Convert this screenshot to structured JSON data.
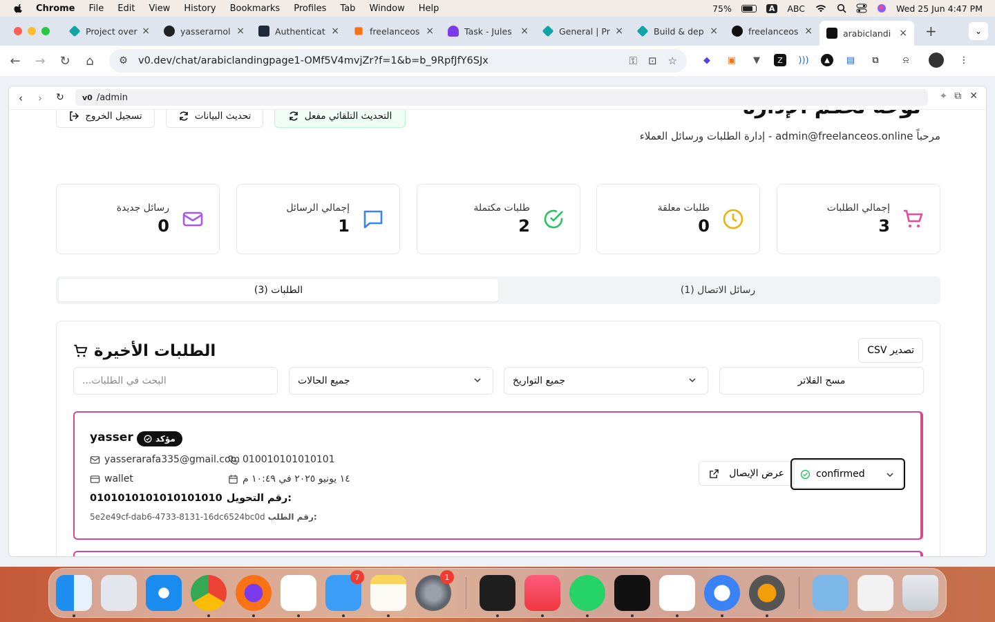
{
  "menubar": {
    "app": "Chrome",
    "items": [
      "File",
      "Edit",
      "View",
      "History",
      "Bookmarks",
      "Profiles",
      "Tab",
      "Window",
      "Help"
    ],
    "battery": "75%",
    "input_badge": "A",
    "input_source": "ABC",
    "datetime": "Wed 25 Jun  4:47 PM"
  },
  "tabs": [
    {
      "label": "Project over",
      "color": "#0ea5a4"
    },
    {
      "label": "yasserarnol",
      "color": "#222222"
    },
    {
      "label": "Authenticat",
      "color": "#1f2937"
    },
    {
      "label": "freelanceos",
      "color": "#f97316"
    },
    {
      "label": "Task - Jules",
      "color": "#7c3aed"
    },
    {
      "label": "General | Pr",
      "color": "#0ea5a4"
    },
    {
      "label": "Build & dep",
      "color": "#0ea5a4"
    },
    {
      "label": "freelanceos",
      "color": "#111111"
    },
    {
      "label": "arabiclandi",
      "color": "#111111"
    }
  ],
  "address": {
    "url": "v0.dev/chat/arabiclandingpage1-OMf5V4mvjZr?f=1&b=b_9RpfJfY6SJx"
  },
  "preview": {
    "path": "/admin",
    "logo": "v0"
  },
  "header": {
    "title": "لوحة تحكم الإدارة",
    "welcome": "مرحباً admin@freelanceos.online - إدارة الطلبات ورسائل العملاء",
    "logout": "تسجيل الخروج",
    "refresh": "تحديث البيانات",
    "auto_refresh": "التحديث التلقائي مفعل"
  },
  "stats": [
    {
      "label": "رسائل جديدة",
      "value": "0",
      "icon": "mail-icon",
      "color": "#a855f7"
    },
    {
      "label": "إجمالي الرسائل",
      "value": "1",
      "icon": "message-icon",
      "color": "#3b82f6"
    },
    {
      "label": "طلبات مكتملة",
      "value": "2",
      "icon": "check-circle-icon",
      "color": "#22c55e"
    },
    {
      "label": "طلبات معلقة",
      "value": "0",
      "icon": "clock-icon",
      "color": "#eab308"
    },
    {
      "label": "إجمالي الطلبات",
      "value": "3",
      "icon": "cart-icon",
      "color": "#ec4899"
    }
  ],
  "page_tabs": {
    "orders": "الطلبات (3)",
    "messages": "رسائل الاتصال (1)"
  },
  "orders_card": {
    "title": "الطلبات الأخيرة",
    "export": "CSV تصدير",
    "search_placeholder": "...البحث في الطلبات",
    "status_filter": "جميع الحالات",
    "date_filter": "جميع التواريخ",
    "clear_filters": "مسح الفلاتر"
  },
  "order": {
    "name": "yasser",
    "badge": "مؤكد",
    "email": "yasserarafa335@gmail.com",
    "phone": "010010101010101",
    "payment": "wallet",
    "date": "١٤ يونيو ٢٠٢٥ في ١٠:٤٩ م",
    "transfer_label": "رقم التحويل:",
    "transfer_number": "0101010101010101010",
    "id_label": "رقم الطلب:",
    "id_value": "5e2e49cf-dab6-4733-8131-16dc6524bc0d",
    "receipt": "عرض الإيصال",
    "status": "confirmed"
  },
  "dock": {
    "mail_badge": "7",
    "settings_badge": "1"
  }
}
